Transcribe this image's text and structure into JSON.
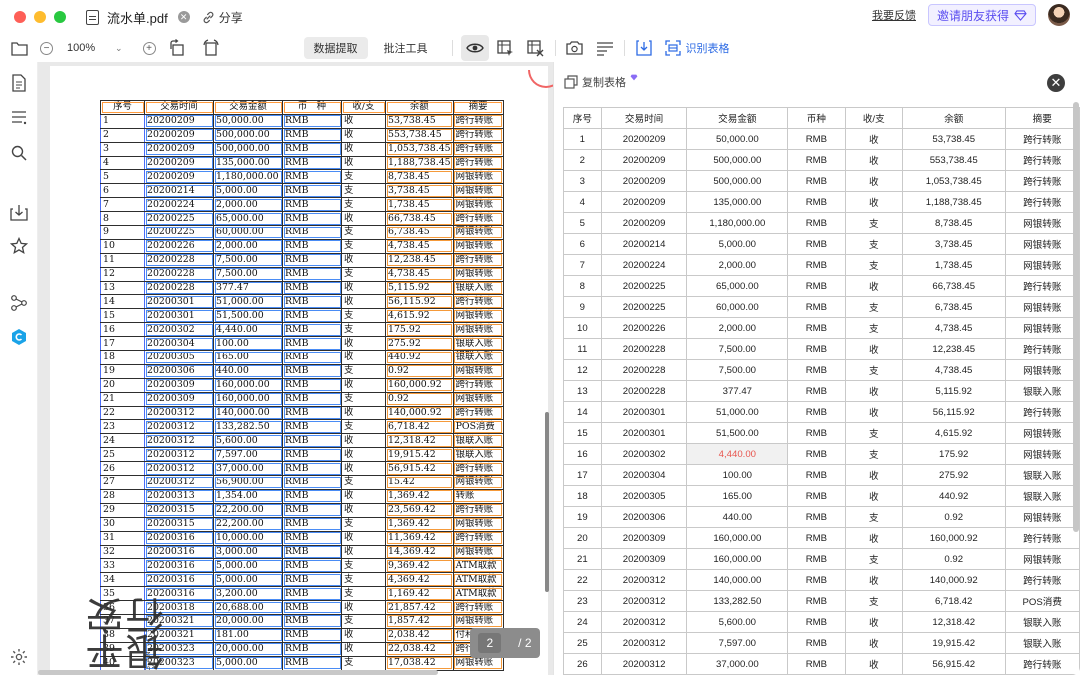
{
  "titlebar": {
    "doc_title": "流水单.pdf",
    "share_label": "分享",
    "feedback_label": "我要反馈",
    "invite_label": "邀请朋友获得"
  },
  "toolbar": {
    "zoom": "100%",
    "tab_extract": "数据提取",
    "tab_annotate": "批注工具",
    "recognize_label": "识别表格"
  },
  "pdf": {
    "headers": [
      "序号",
      "交易时间",
      "交易金额",
      "币　种",
      "收/支",
      "余额",
      "摘要"
    ],
    "rows": [
      [
        "1",
        "20200209",
        "50,000.00",
        "RMB",
        "收",
        "53,738.45",
        "跨行转账"
      ],
      [
        "2",
        "20200209",
        "500,000.00",
        "RMB",
        "收",
        "553,738.45",
        "跨行转账"
      ],
      [
        "3",
        "20200209",
        "500,000.00",
        "RMB",
        "收",
        "1,053,738.45",
        "跨行转账"
      ],
      [
        "4",
        "20200209",
        "135,000.00",
        "RMB",
        "收",
        "1,188,738.45",
        "跨行转账"
      ],
      [
        "5",
        "20200209",
        "1,180,000.00",
        "RMB",
        "支",
        "8,738.45",
        "网银转账"
      ],
      [
        "6",
        "20200214",
        "5,000.00",
        "RMB",
        "支",
        "3,738.45",
        "网银转账"
      ],
      [
        "7",
        "20200224",
        "2,000.00",
        "RMB",
        "支",
        "1,738.45",
        "网银转账"
      ],
      [
        "8",
        "20200225",
        "65,000.00",
        "RMB",
        "收",
        "66,738.45",
        "跨行转账"
      ],
      [
        "9",
        "20200225",
        "60,000.00",
        "RMB",
        "支",
        "6,738.45",
        "网银转账"
      ],
      [
        "10",
        "20200226",
        "2,000.00",
        "RMB",
        "支",
        "4,738.45",
        "网银转账"
      ],
      [
        "11",
        "20200228",
        "7,500.00",
        "RMB",
        "收",
        "12,238.45",
        "跨行转账"
      ],
      [
        "12",
        "20200228",
        "7,500.00",
        "RMB",
        "支",
        "4,738.45",
        "网银转账"
      ],
      [
        "13",
        "20200228",
        "377.47",
        "RMB",
        "收",
        "5,115.92",
        "银联入账"
      ],
      [
        "14",
        "20200301",
        "51,000.00",
        "RMB",
        "收",
        "56,115.92",
        "跨行转账"
      ],
      [
        "15",
        "20200301",
        "51,500.00",
        "RMB",
        "支",
        "4,615.92",
        "网银转账"
      ],
      [
        "16",
        "20200302",
        "4,440.00",
        "RMB",
        "支",
        "175.92",
        "网银转账"
      ],
      [
        "17",
        "20200304",
        "100.00",
        "RMB",
        "收",
        "275.92",
        "银联入账"
      ],
      [
        "18",
        "20200305",
        "165.00",
        "RMB",
        "收",
        "440.92",
        "银联入账"
      ],
      [
        "19",
        "20200306",
        "440.00",
        "RMB",
        "支",
        "0.92",
        "网银转账"
      ],
      [
        "20",
        "20200309",
        "160,000.00",
        "RMB",
        "收",
        "160,000.92",
        "跨行转账"
      ],
      [
        "21",
        "20200309",
        "160,000.00",
        "RMB",
        "支",
        "0.92",
        "网银转账"
      ],
      [
        "22",
        "20200312",
        "140,000.00",
        "RMB",
        "收",
        "140,000.92",
        "跨行转账"
      ],
      [
        "23",
        "20200312",
        "133,282.50",
        "RMB",
        "支",
        "6,718.42",
        "POS消费"
      ],
      [
        "24",
        "20200312",
        "5,600.00",
        "RMB",
        "收",
        "12,318.42",
        "银联入账"
      ],
      [
        "25",
        "20200312",
        "7,597.00",
        "RMB",
        "收",
        "19,915.42",
        "银联入账"
      ],
      [
        "26",
        "20200312",
        "37,000.00",
        "RMB",
        "收",
        "56,915.42",
        "跨行转账"
      ],
      [
        "27",
        "20200312",
        "56,900.00",
        "RMB",
        "支",
        "15.42",
        "网银转账"
      ],
      [
        "28",
        "20200313",
        "1,354.00",
        "RMB",
        "收",
        "1,369.42",
        "转账"
      ],
      [
        "29",
        "20200315",
        "22,200.00",
        "RMB",
        "收",
        "23,569.42",
        "跨行转账"
      ],
      [
        "30",
        "20200315",
        "22,200.00",
        "RMB",
        "支",
        "1,369.42",
        "网银转账"
      ],
      [
        "31",
        "20200316",
        "10,000.00",
        "RMB",
        "收",
        "11,369.42",
        "跨行转账"
      ],
      [
        "32",
        "20200316",
        "3,000.00",
        "RMB",
        "收",
        "14,369.42",
        "网银转账"
      ],
      [
        "33",
        "20200316",
        "5,000.00",
        "RMB",
        "支",
        "9,369.42",
        "ATM取款"
      ],
      [
        "34",
        "20200316",
        "5,000.00",
        "RMB",
        "支",
        "4,369.42",
        "ATM取款"
      ],
      [
        "35",
        "20200316",
        "3,200.00",
        "RMB",
        "支",
        "1,169.42",
        "ATM取款"
      ],
      [
        "36",
        "20200318",
        "20,688.00",
        "RMB",
        "收",
        "21,857.42",
        "跨行转账"
      ],
      [
        "37",
        "20200321",
        "20,000.00",
        "RMB",
        "支",
        "1,857.42",
        "网银转账"
      ],
      [
        "38",
        "20200321",
        "181.00",
        "RMB",
        "收",
        "2,038.42",
        "付利息"
      ],
      [
        "39",
        "20200323",
        "20,000.00",
        "RMB",
        "收",
        "22,038.42",
        "跨行转账"
      ],
      [
        "40",
        "20200323",
        "5,000.00",
        "RMB",
        "支",
        "17,038.42",
        "网银转账"
      ]
    ],
    "stamp_text": "平安银行",
    "stamp_en": "PING AN BANK",
    "page_current": "2",
    "page_total": "/ 2"
  },
  "result": {
    "copy_label": "复制表格",
    "headers": [
      "序号",
      "交易时间",
      "交易金额",
      "币种",
      "收/支",
      "余额",
      "摘要"
    ],
    "rows": [
      [
        "1",
        "20200209",
        "50,000.00",
        "RMB",
        "收",
        "53,738.45",
        "跨行转账"
      ],
      [
        "2",
        "20200209",
        "500,000.00",
        "RMB",
        "收",
        "553,738.45",
        "跨行转账"
      ],
      [
        "3",
        "20200209",
        "500,000.00",
        "RMB",
        "收",
        "1,053,738.45",
        "跨行转账"
      ],
      [
        "4",
        "20200209",
        "135,000.00",
        "RMB",
        "收",
        "1,188,738.45",
        "跨行转账"
      ],
      [
        "5",
        "20200209",
        "1,180,000.00",
        "RMB",
        "支",
        "8,738.45",
        "网银转账"
      ],
      [
        "6",
        "20200214",
        "5,000.00",
        "RMB",
        "支",
        "3,738.45",
        "网银转账"
      ],
      [
        "7",
        "20200224",
        "2,000.00",
        "RMB",
        "支",
        "1,738.45",
        "网银转账"
      ],
      [
        "8",
        "20200225",
        "65,000.00",
        "RMB",
        "收",
        "66,738.45",
        "跨行转账"
      ],
      [
        "9",
        "20200225",
        "60,000.00",
        "RMB",
        "支",
        "6,738.45",
        "网银转账"
      ],
      [
        "10",
        "20200226",
        "2,000.00",
        "RMB",
        "支",
        "4,738.45",
        "网银转账"
      ],
      [
        "11",
        "20200228",
        "7,500.00",
        "RMB",
        "收",
        "12,238.45",
        "跨行转账"
      ],
      [
        "12",
        "20200228",
        "7,500.00",
        "RMB",
        "支",
        "4,738.45",
        "网银转账"
      ],
      [
        "13",
        "20200228",
        "377.47",
        "RMB",
        "收",
        "5,115.92",
        "银联入账"
      ],
      [
        "14",
        "20200301",
        "51,000.00",
        "RMB",
        "收",
        "56,115.92",
        "跨行转账"
      ],
      [
        "15",
        "20200301",
        "51,500.00",
        "RMB",
        "支",
        "4,615.92",
        "网银转账"
      ],
      [
        "16",
        "20200302",
        "4,440.00",
        "RMB",
        "支",
        "175.92",
        "网银转账"
      ],
      [
        "17",
        "20200304",
        "100.00",
        "RMB",
        "收",
        "275.92",
        "银联入账"
      ],
      [
        "18",
        "20200305",
        "165.00",
        "RMB",
        "收",
        "440.92",
        "银联入账"
      ],
      [
        "19",
        "20200306",
        "440.00",
        "RMB",
        "支",
        "0.92",
        "网银转账"
      ],
      [
        "20",
        "20200309",
        "160,000.00",
        "RMB",
        "收",
        "160,000.92",
        "跨行转账"
      ],
      [
        "21",
        "20200309",
        "160,000.00",
        "RMB",
        "支",
        "0.92",
        "网银转账"
      ],
      [
        "22",
        "20200312",
        "140,000.00",
        "RMB",
        "收",
        "140,000.92",
        "跨行转账"
      ],
      [
        "23",
        "20200312",
        "133,282.50",
        "RMB",
        "支",
        "6,718.42",
        "POS消费"
      ],
      [
        "24",
        "20200312",
        "5,600.00",
        "RMB",
        "收",
        "12,318.42",
        "银联入账"
      ],
      [
        "25",
        "20200312",
        "7,597.00",
        "RMB",
        "收",
        "19,915.42",
        "银联入账"
      ],
      [
        "26",
        "20200312",
        "37,000.00",
        "RMB",
        "收",
        "56,915.42",
        "跨行转账"
      ]
    ],
    "highlight_row": 15,
    "highlight_col": 2
  },
  "colors": {
    "accent": "#2d6be4",
    "invite": "#5a4cf0",
    "highlight_text": "#e8554e"
  }
}
